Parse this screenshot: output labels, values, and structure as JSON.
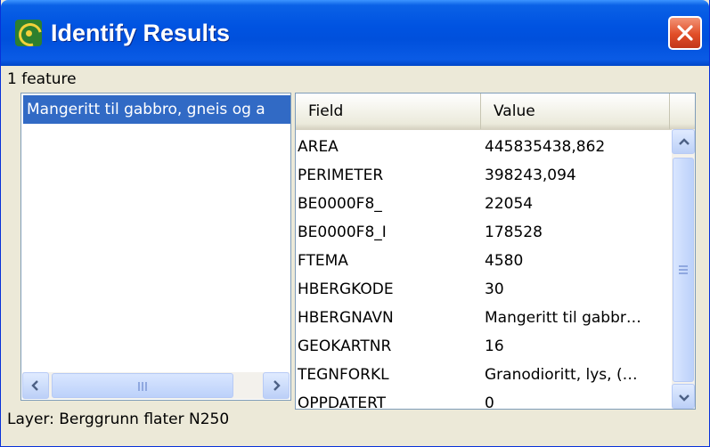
{
  "window": {
    "title": "Identify Results",
    "icon": "app-logo-icon",
    "close_icon": "close-icon"
  },
  "results": {
    "feature_count": "1 feature",
    "features": [
      "Mangeritt til gabbro, gneis og a"
    ],
    "layer_label": "Layer: Berggrunn flater N250"
  },
  "table": {
    "headers": {
      "field": "Field",
      "value": "Value"
    },
    "rows": [
      {
        "field": "AREA",
        "value": "445835438,862"
      },
      {
        "field": "PERIMETER",
        "value": "398243,094"
      },
      {
        "field": "BE0000F8_",
        "value": "22054"
      },
      {
        "field": "BE0000F8_I",
        "value": "178528"
      },
      {
        "field": "FTEMA",
        "value": "4580"
      },
      {
        "field": "HBERGKODE",
        "value": "30"
      },
      {
        "field": "HBERGNAVN",
        "value": "Mangeritt til gabbr…"
      },
      {
        "field": "GEOKARTNR",
        "value": "16"
      },
      {
        "field": "TEGNFORKL",
        "value": "Granodioritt, lys, (…"
      },
      {
        "field": "OPPDATERT",
        "value": "0"
      }
    ]
  },
  "colors": {
    "titlebar": "#0053E1",
    "selection": "#316AC5",
    "close_button": "#E14E28",
    "window_bg": "#ECE9D8"
  }
}
